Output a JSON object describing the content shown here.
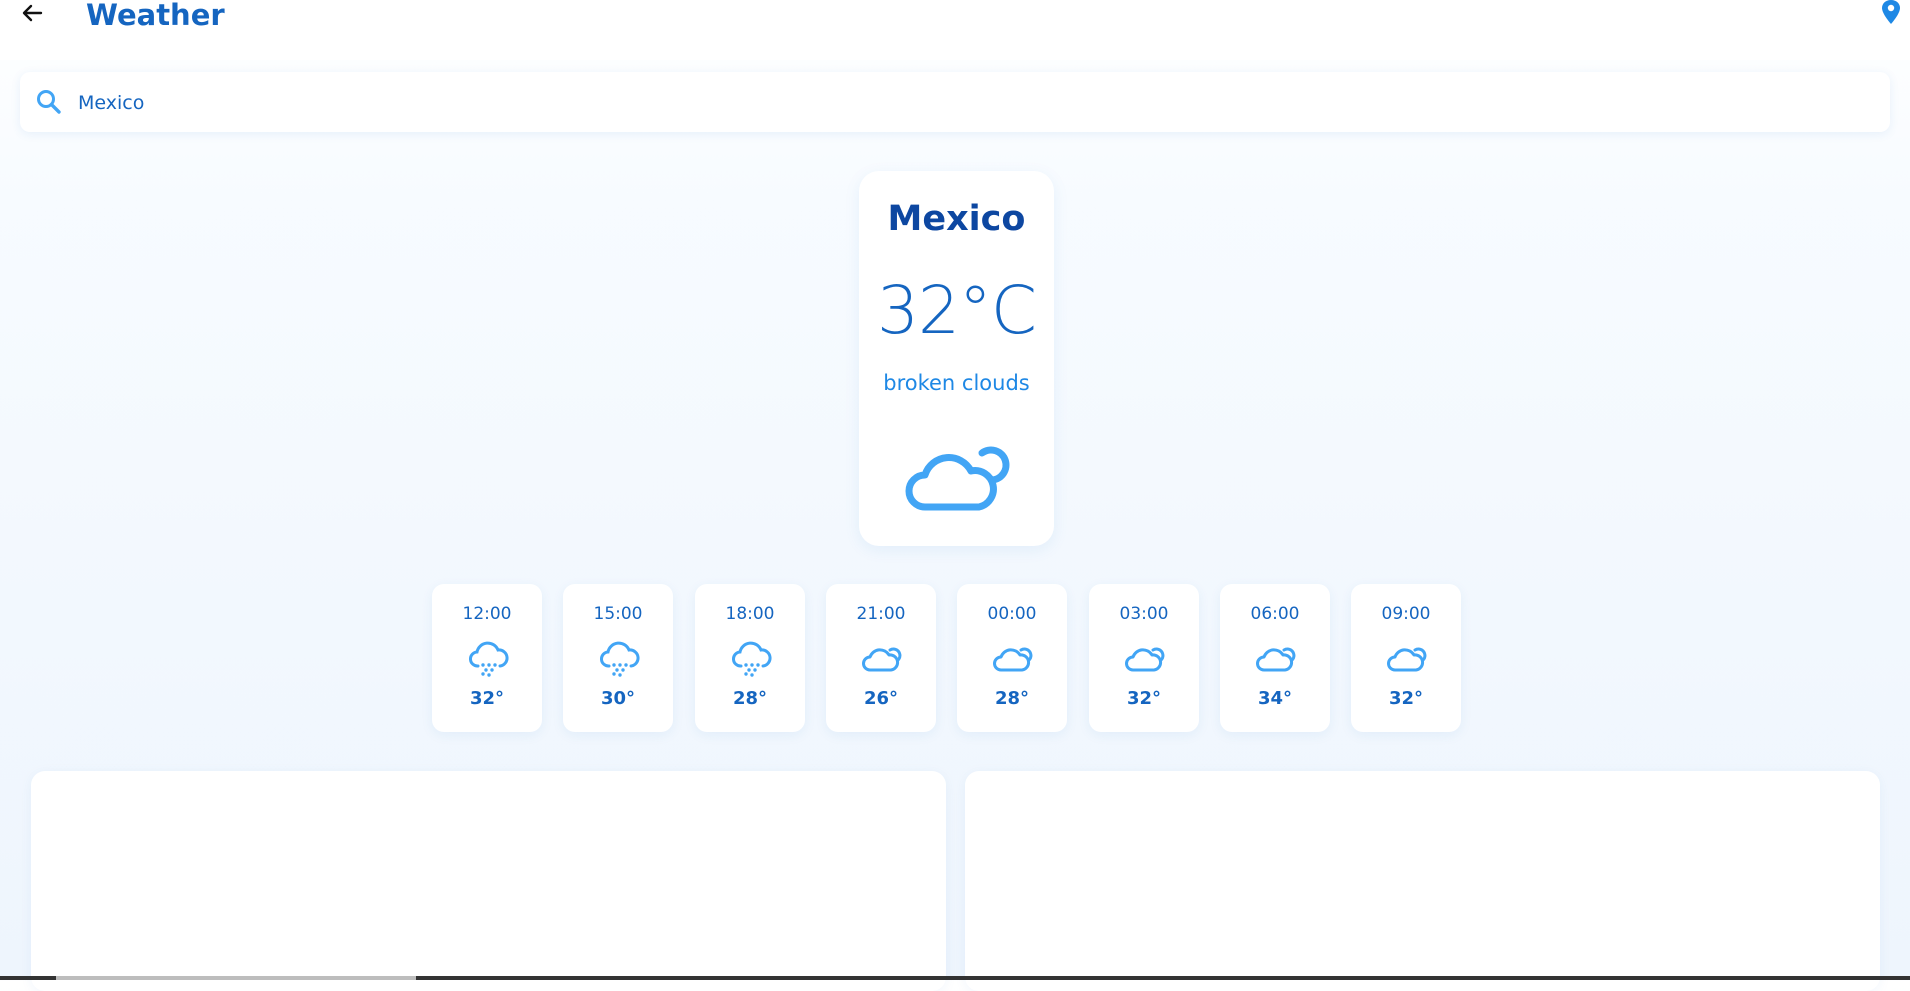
{
  "header": {
    "title": "Weather",
    "back_icon": "arrow-back-icon",
    "location_icon": "location-pin-icon"
  },
  "search": {
    "value": "Mexico",
    "icon": "search-icon"
  },
  "current": {
    "city": "Mexico",
    "temperature": "32°C",
    "description": "broken clouds",
    "icon": "broken-clouds-icon"
  },
  "hourly": [
    {
      "time": "12:00",
      "temp": "32°",
      "icon": "rain-icon"
    },
    {
      "time": "15:00",
      "temp": "30°",
      "icon": "rain-icon"
    },
    {
      "time": "18:00",
      "temp": "28°",
      "icon": "rain-icon"
    },
    {
      "time": "21:00",
      "temp": "26°",
      "icon": "broken-clouds-icon"
    },
    {
      "time": "00:00",
      "temp": "28°",
      "icon": "broken-clouds-icon"
    },
    {
      "time": "03:00",
      "temp": "32°",
      "icon": "broken-clouds-icon"
    },
    {
      "time": "06:00",
      "temp": "34°",
      "icon": "broken-clouds-icon"
    },
    {
      "time": "09:00",
      "temp": "32°",
      "icon": "broken-clouds-icon"
    }
  ],
  "colors": {
    "accent": "#1565c0",
    "icon_blue": "#42a5f5",
    "title_dark": "#0d47a1"
  }
}
